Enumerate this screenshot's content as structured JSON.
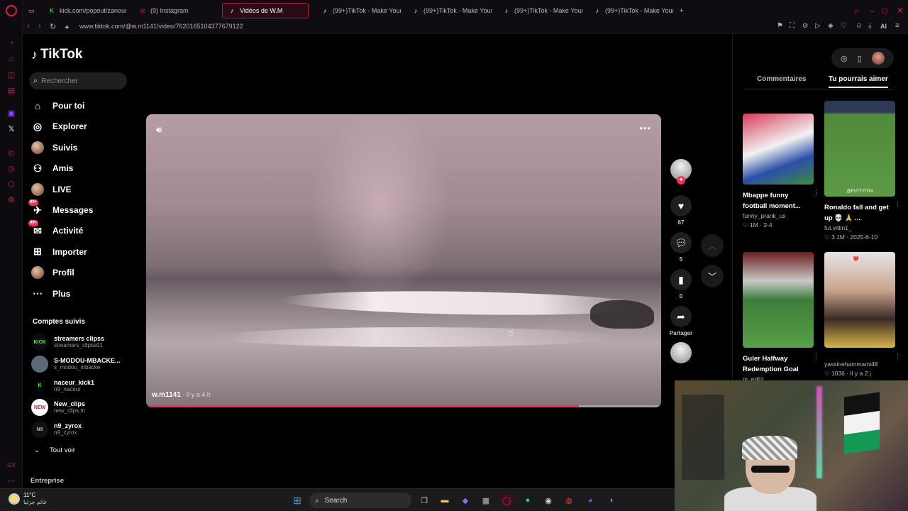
{
  "browser": {
    "tabs": [
      {
        "label": "kick.com/popout/zanouni/",
        "favicon": "kick-icon",
        "color": "#53fc18"
      },
      {
        "label": "(9) Instagram",
        "favicon": "instagram-icon",
        "color": "#e1306c"
      },
      {
        "label": "Vidéos de W.M",
        "favicon": "tiktok-icon",
        "color": "#ffffff",
        "active": true
      },
      {
        "label": "(99+)TikTok - Make Your",
        "favicon": "tiktok-icon",
        "color": "#ffffff"
      },
      {
        "label": "(99+)TikTok - Make Your",
        "favicon": "tiktok-icon",
        "color": "#ffffff"
      },
      {
        "label": "(99+)TikTok - Make Your",
        "favicon": "tiktok-icon",
        "color": "#ffffff"
      },
      {
        "label": "(99+)TikTok - Make Your",
        "favicon": "tiktok-icon",
        "color": "#ffffff"
      }
    ],
    "new_tab": "+",
    "url": "www.tiktok.com/@w.m1141/video/7620165104377679122",
    "extension_label": "AI",
    "accent": "#e21e4f"
  },
  "sidebar": {
    "logo": "TikTok",
    "search_placeholder": "Rechercher",
    "nav": [
      {
        "label": "Pour toi",
        "icon": "home-icon"
      },
      {
        "label": "Explorer",
        "icon": "compass-icon"
      },
      {
        "label": "Suivis",
        "icon": "following-avatar-icon"
      },
      {
        "label": "Amis",
        "icon": "friends-icon"
      },
      {
        "label": "LIVE",
        "icon": "live-avatar-icon"
      },
      {
        "label": "Messages",
        "icon": "messages-icon",
        "badge": "99+"
      },
      {
        "label": "Activité",
        "icon": "activity-icon",
        "badge": "99+"
      },
      {
        "label": "Importer",
        "icon": "upload-icon"
      },
      {
        "label": "Profil",
        "icon": "profile-avatar-icon"
      },
      {
        "label": "Plus",
        "icon": "more-icon"
      }
    ],
    "followed_title": "Comptes suivis",
    "followed": [
      {
        "name": "streamers clipss",
        "handle": "streamers_clipss01",
        "avatar_text": "KICK",
        "avatar_bg": "#0b0b0b",
        "avatar_fg": "#53fc18"
      },
      {
        "name": "S-MODOU-MBACKE...",
        "handle": "s_modou_mbacke",
        "avatar_text": "",
        "avatar_bg": "#5b6a77",
        "avatar_fg": "#fff"
      },
      {
        "name": "naceur_kick1",
        "handle": "n9_naceur",
        "avatar_text": "K",
        "avatar_bg": "#000000",
        "avatar_fg": "#53fc18"
      },
      {
        "name": "New_clips",
        "handle": "new_clips.tn",
        "avatar_text": "NEW",
        "avatar_bg": "#ffffff",
        "avatar_fg": "#d4145a"
      },
      {
        "name": "n9_zyrox",
        "handle": "n9_zyrox",
        "avatar_text": "N9",
        "avatar_bg": "#111111",
        "avatar_fg": "#bbb"
      }
    ],
    "see_all": "Tout voir",
    "footer": "Entreprise"
  },
  "video": {
    "author": "w.m1141",
    "ago": " · Il y a 4 h",
    "progress": 0.84
  },
  "actions": {
    "likes": "67",
    "comments": "5",
    "saves": "0",
    "share_label": "Partager"
  },
  "right_panel": {
    "tabs": [
      "Commentaires",
      "Tu pourrais aimer"
    ],
    "active_tab": 1,
    "cards": [
      {
        "title": "Mbappe funny football moment...",
        "author": "funny_prank_us",
        "meta": "♡ 1M · 2-4",
        "thumb_style": "mbappe"
      },
      {
        "title": "Ronaldo fall and get up 💀 🙏 ...",
        "author": "fut.vittin1_",
        "meta": "♡ 3.1M · 2025-6-10",
        "thumb_style": "pitch",
        "thumb_text": "@FUTTYITIN"
      },
      {
        "title": "Guler Halfway Redemption Goal",
        "author": "m_editz",
        "meta": "",
        "thumb_style": "stadium"
      },
      {
        "title": "",
        "author": "yassinehammami48",
        "meta": "♡ 1036 · Il y a 2 j",
        "thumb_style": "selfie",
        "thumb_text": "I❤️"
      }
    ]
  },
  "taskbar": {
    "temperature": "11°C",
    "weather_text": "غائم جزئيا",
    "search_label": "Search"
  }
}
